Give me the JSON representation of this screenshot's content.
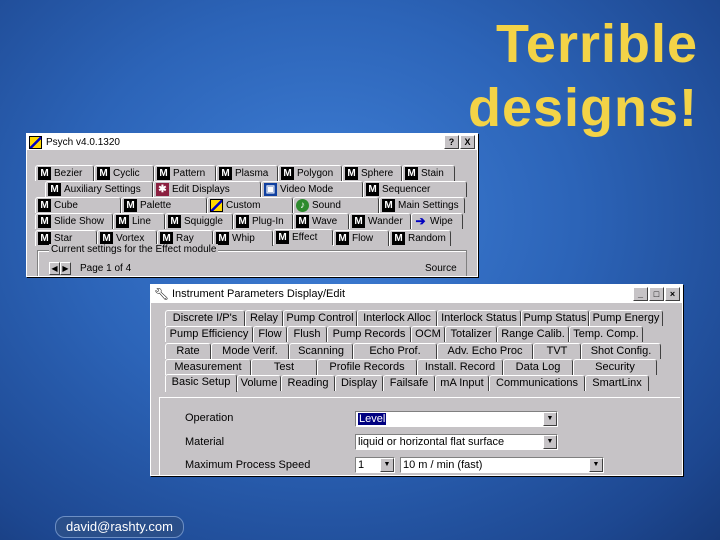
{
  "slide": {
    "title_line1": "Terrible",
    "title_line2": "designs!",
    "footer": "david@rashty.com",
    "colors": {
      "title": "#f3d347",
      "background": "#2c64b8"
    }
  },
  "window1": {
    "title": "Psych v4.0.1320",
    "help_button": "?",
    "close_button": "X",
    "tab_rows": [
      [
        "Bezier",
        "Cyclic",
        "Pattern",
        "Plasma",
        "Polygon",
        "Sphere",
        "Stain"
      ],
      [
        "Auxiliary Settings",
        "Edit Displays",
        "Video Mode",
        "Sequencer"
      ],
      [
        "Cube",
        "Palette",
        "Custom",
        "Sound",
        "Main Settings"
      ],
      [
        "Slide Show",
        "Line",
        "Squiggle",
        "Plug-In",
        "Wave",
        "Wander",
        "Wipe"
      ],
      [
        "Star",
        "Vortex",
        "Ray",
        "Whip",
        "Effect",
        "Flow",
        "Random"
      ]
    ],
    "group_label": "Current settings for the Effect module",
    "page_label": "Page 1 of 4",
    "source_label": "Source",
    "spinner_left": "◀",
    "spinner_right": "▶"
  },
  "window2": {
    "title": "Instrument Parameters Display/Edit",
    "tab_rows": [
      [
        "Discrete I/P's",
        "Relay",
        "Pump Control",
        "Interlock Alloc",
        "Interlock Status",
        "Pump Status",
        "Pump Energy"
      ],
      [
        "Pump Efficiency",
        "Flow",
        "Flush",
        "Pump Records",
        "OCM",
        "Totalizer",
        "Range Calib.",
        "Temp. Comp."
      ],
      [
        "Rate",
        "Mode Verif.",
        "Scanning",
        "Echo Prof.",
        "Adv. Echo Proc",
        "TVT",
        "Shot Config."
      ],
      [
        "Measurement",
        "Test",
        "Profile Records",
        "Install. Record",
        "Data Log",
        "Security"
      ],
      [
        "Basic Setup",
        "Volume",
        "Reading",
        "Display",
        "Failsafe",
        "mA Input",
        "Communications",
        "SmartLinx"
      ]
    ],
    "fields": [
      {
        "label": "Operation",
        "value": "Level"
      },
      {
        "label": "Material",
        "value": "liquid or horizontal flat surface"
      },
      {
        "label": "Maximum Process Speed",
        "value": "1",
        "value2": "10 m / min (fast)"
      }
    ]
  }
}
